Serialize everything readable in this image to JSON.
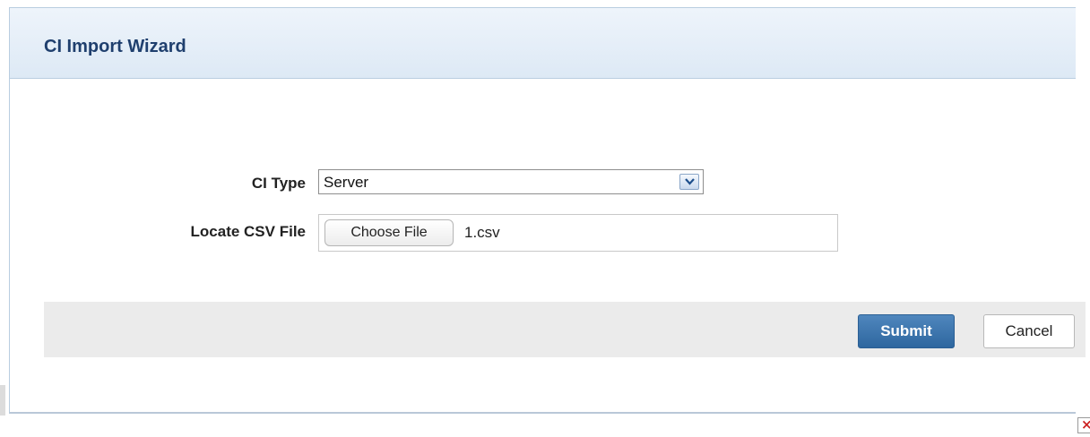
{
  "dialog": {
    "title": "CI Import Wizard"
  },
  "form": {
    "ci_type": {
      "label": "CI Type",
      "selected": "Server"
    },
    "csv_file": {
      "label": "Locate CSV File",
      "button_label": "Choose File",
      "file_name": "1.csv"
    }
  },
  "actions": {
    "submit_label": "Submit",
    "cancel_label": "Cancel"
  },
  "icons": {
    "select_arrow": "chevron-down-icon",
    "corner": "close-icon"
  },
  "colors": {
    "title": "#1f3f6e",
    "submit_bg": "#2e679f",
    "header_bg": "#dde9f5",
    "action_bar_bg": "#ebebeb",
    "close_mark": "#cc2222"
  }
}
